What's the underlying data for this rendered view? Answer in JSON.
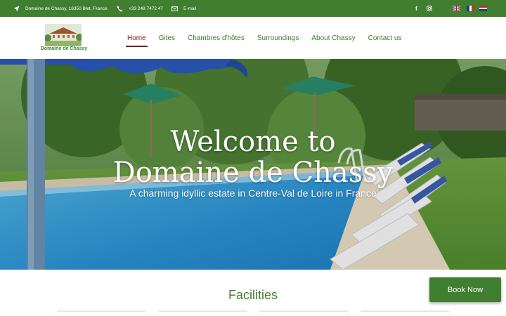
{
  "topbar": {
    "address": "Domaine de Chassy, 18350 Blet, France",
    "phone": "+33 248 7472 47",
    "email_label": "E-mail",
    "social": [
      {
        "name": "facebook",
        "glyph": "f"
      },
      {
        "name": "instagram",
        "glyph": "◎"
      }
    ],
    "languages": [
      "English",
      "Français",
      "Nederlands"
    ],
    "background": "#3f7f2f"
  },
  "header": {
    "logo_text": "Domaine de Chassy",
    "nav": [
      {
        "label": "Home",
        "active": true
      },
      {
        "label": "Gites",
        "active": false
      },
      {
        "label": "Chambres d'hôtes",
        "active": false
      },
      {
        "label": "Surroundings",
        "active": false
      },
      {
        "label": "About Chassy",
        "active": false
      },
      {
        "label": "Contact us",
        "active": false
      }
    ],
    "active_color": "#7a1a1a",
    "link_color": "#3a7a2a"
  },
  "hero": {
    "title_line1": "Welcome to",
    "title_line2": "Domaine de Chassy",
    "subtitle": "A charming idyllic estate in Centre-Val de Loire in France"
  },
  "facilities": {
    "title": "Facilities"
  },
  "book_now": {
    "label": "Book Now"
  },
  "brand_colors": {
    "green": "#3f7f2f",
    "maroon": "#7a1a1a"
  }
}
